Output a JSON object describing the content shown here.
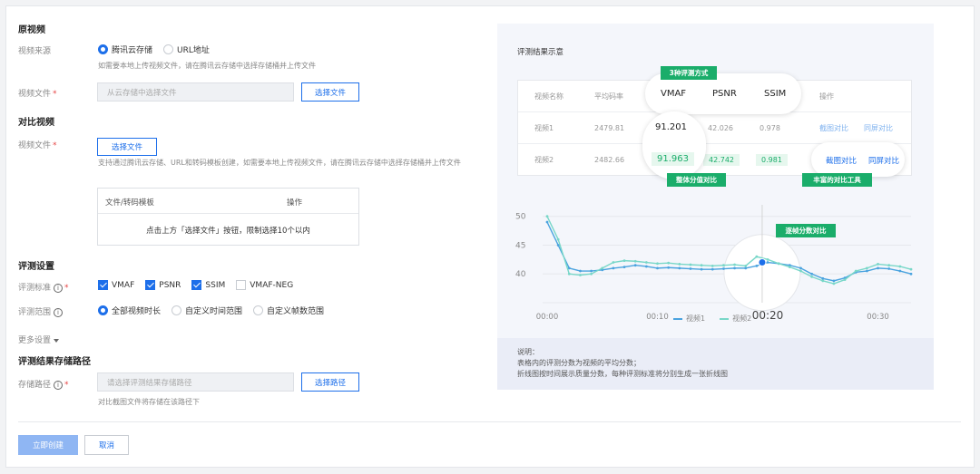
{
  "form": {
    "source_section": "原视频",
    "source_label": "视频来源",
    "source_options": [
      "腾讯云存储",
      "URL地址"
    ],
    "source_hint": "如需要本地上传视频文件，请在腾讯云存储中选择存储桶并上传文件",
    "file_label": "视频文件",
    "file_placeholder": "从云存储中选择文件",
    "select_file_button": "选择文件",
    "compare_section": "对比视频",
    "compare_file_label": "视频文件",
    "compare_select_button": "选择文件",
    "compare_hint": "支持通过腾讯云存储、URL和转码模板创建，如需要本地上传视频文件，请在腾讯云存储中选择存储桶并上传文件",
    "compare_table": {
      "col_file": "文件/转码模板",
      "col_action": "操作",
      "empty": "点击上方「选择文件」按钮，限制选择10个以内"
    },
    "eval_section": "评测设置",
    "metric_label": "评测标准",
    "metrics": [
      {
        "label": "VMAF",
        "checked": true
      },
      {
        "label": "PSNR",
        "checked": true
      },
      {
        "label": "SSIM",
        "checked": true
      },
      {
        "label": "VMAF-NEG",
        "checked": false
      }
    ],
    "range_label": "评测范围",
    "ranges": [
      "全部视频时长",
      "自定义时间范围",
      "自定义帧数范围"
    ],
    "more_settings": "更多设置",
    "path_section": "评测结果存储路径",
    "path_label": "存储路径",
    "path_placeholder": "请选择评测结果存储路径",
    "path_button": "选择路径",
    "path_hint": "对比截图文件将存储在该路径下",
    "create_button": "立即创建",
    "cancel_button": "取消"
  },
  "preview": {
    "title": "评测结果示意",
    "headers": [
      "视频名称",
      "平均码率",
      "VMAF",
      "PSNR",
      "SSIM",
      "操作"
    ],
    "rows": [
      {
        "name": "视频1",
        "bitrate": "2479.81",
        "vmaf": "91.201",
        "psnr": "42.026",
        "ssim": "0.978",
        "action1": "截图对比",
        "action2": "同屏对比"
      },
      {
        "name": "视频2",
        "bitrate": "2482.66",
        "vmaf": "91.963",
        "psnr": "42.742",
        "ssim": "0.981",
        "action1": "截图对比",
        "action2": "同屏对比"
      }
    ],
    "tags": {
      "methods": "3种评测方式",
      "overall": "整体分值对比",
      "tools": "丰富的对比工具",
      "per_frame": "逐帧分数对比"
    },
    "note_title": "说明：",
    "note_lines": [
      "表格内的评测分数为视频的平均分数；",
      "折线图按时间展示质量分数，每种评测标准将分别生成一张折线图"
    ]
  },
  "chart_data": {
    "type": "line",
    "x": [
      0,
      1,
      2,
      3,
      4,
      5,
      6,
      7,
      8,
      9,
      10,
      11,
      12,
      13,
      14,
      15,
      16,
      17,
      18,
      19,
      20,
      21,
      22,
      23,
      24,
      25,
      26,
      27,
      28,
      29,
      30,
      31,
      32,
      33
    ],
    "x_tick_labels": [
      "00:00",
      "00:10",
      "00:20",
      "00:30"
    ],
    "x_ticks": [
      0,
      10,
      20,
      30
    ],
    "y_ticks": [
      40,
      45,
      50
    ],
    "ylim": [
      35,
      52
    ],
    "series": [
      {
        "name": "视频1",
        "color": "#4aa3df",
        "values": [
          49,
          45,
          41,
          40.5,
          40.5,
          40.7,
          41,
          41.2,
          41.5,
          41.3,
          41,
          41.1,
          41,
          40.9,
          40.8,
          40.8,
          40.9,
          41,
          41,
          41.4,
          42,
          41.8,
          41.5,
          41,
          40,
          39.2,
          38.8,
          39.3,
          40.3,
          40.5,
          41,
          40.9,
          40.5,
          40
        ]
      },
      {
        "name": "视频2",
        "color": "#78d7c8",
        "values": [
          50,
          46,
          40,
          39.8,
          40,
          41,
          42,
          42.3,
          42.2,
          42,
          41.8,
          41.9,
          41.7,
          41.6,
          41.5,
          41.4,
          41.5,
          41.6,
          41.4,
          43,
          42.5,
          41.8,
          41.2,
          40.5,
          39.5,
          38.8,
          38.3,
          39,
          40.5,
          41,
          41.7,
          41.5,
          41.3,
          40.8
        ]
      }
    ],
    "legend_position": "bottom-center"
  }
}
